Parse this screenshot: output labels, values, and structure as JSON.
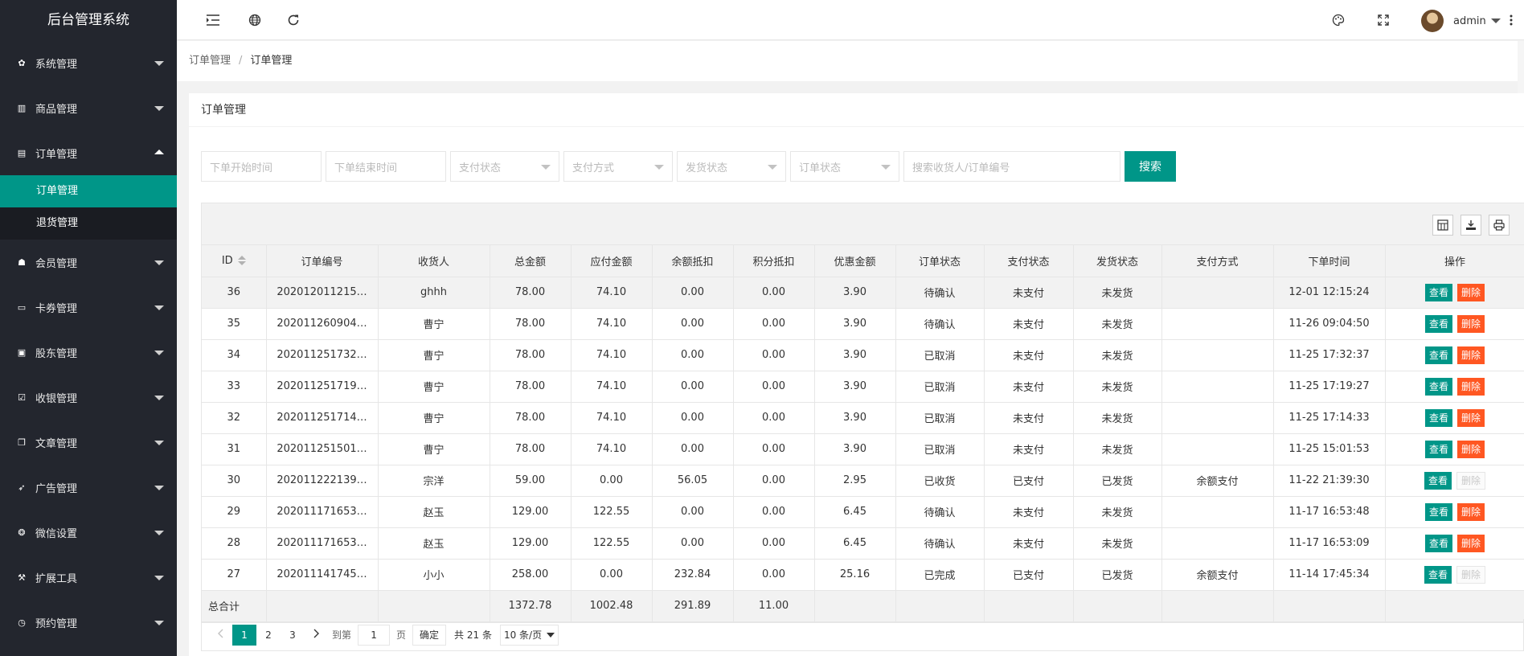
{
  "app": {
    "title": "后台管理系统",
    "username": "admin"
  },
  "sidebar": {
    "items": [
      {
        "label": "系统管理",
        "icon": "gear-icon"
      },
      {
        "label": "商品管理",
        "icon": "chart-icon"
      },
      {
        "label": "订单管理",
        "icon": "calendar-icon",
        "open": true
      },
      {
        "label": "会员管理",
        "icon": "users-icon"
      },
      {
        "label": "卡券管理",
        "icon": "card-icon"
      },
      {
        "label": "股东管理",
        "icon": "contact-icon"
      },
      {
        "label": "收银管理",
        "icon": "check-square-icon"
      },
      {
        "label": "文章管理",
        "icon": "file-icon"
      },
      {
        "label": "广告管理",
        "icon": "rocket-icon"
      },
      {
        "label": "微信设置",
        "icon": "wechat-icon"
      },
      {
        "label": "扩展工具",
        "icon": "wrench-icon"
      },
      {
        "label": "预约管理",
        "icon": "clock-icon"
      }
    ],
    "submenu": [
      {
        "label": "订单管理",
        "active": true
      },
      {
        "label": "退货管理",
        "active": false
      }
    ]
  },
  "breadcrumb": {
    "parent": "订单管理",
    "sep": "/",
    "current": "订单管理"
  },
  "card": {
    "title": "订单管理"
  },
  "filters": {
    "start_time": "下单开始时间",
    "end_time": "下单结束时间",
    "pay_status": "支付状态",
    "pay_method": "支付方式",
    "ship_status": "发货状态",
    "order_status": "订单状态",
    "keyword": "搜索收货人/订单编号",
    "search": "搜索"
  },
  "table": {
    "columns": [
      "ID",
      "订单编号",
      "收货人",
      "总金额",
      "应付金额",
      "余额抵扣",
      "积分抵扣",
      "优惠金额",
      "订单状态",
      "支付状态",
      "发货状态",
      "支付方式",
      "下单时间",
      "操作"
    ],
    "rows": [
      [
        "36",
        "202012011215…",
        "ghhh",
        "78.00",
        "74.10",
        "0.00",
        "0.00",
        "3.90",
        "待确认",
        "未支付",
        "未发货",
        "",
        "12-01 12:15:24"
      ],
      [
        "35",
        "202011260904…",
        "曹宁",
        "78.00",
        "74.10",
        "0.00",
        "0.00",
        "3.90",
        "待确认",
        "未支付",
        "未发货",
        "",
        "11-26 09:04:50"
      ],
      [
        "34",
        "202011251732…",
        "曹宁",
        "78.00",
        "74.10",
        "0.00",
        "0.00",
        "3.90",
        "已取消",
        "未支付",
        "未发货",
        "",
        "11-25 17:32:37"
      ],
      [
        "33",
        "202011251719…",
        "曹宁",
        "78.00",
        "74.10",
        "0.00",
        "0.00",
        "3.90",
        "已取消",
        "未支付",
        "未发货",
        "",
        "11-25 17:19:27"
      ],
      [
        "32",
        "202011251714…",
        "曹宁",
        "78.00",
        "74.10",
        "0.00",
        "0.00",
        "3.90",
        "已取消",
        "未支付",
        "未发货",
        "",
        "11-25 17:14:33"
      ],
      [
        "31",
        "202011251501…",
        "曹宁",
        "78.00",
        "74.10",
        "0.00",
        "0.00",
        "3.90",
        "已取消",
        "未支付",
        "未发货",
        "",
        "11-25 15:01:53"
      ],
      [
        "30",
        "202011222139…",
        "宗洋",
        "59.00",
        "0.00",
        "56.05",
        "0.00",
        "2.95",
        "已收货",
        "已支付",
        "已发货",
        "余额支付",
        "11-22 21:39:30"
      ],
      [
        "29",
        "202011171653…",
        "赵玉",
        "129.00",
        "122.55",
        "0.00",
        "0.00",
        "6.45",
        "待确认",
        "未支付",
        "未发货",
        "",
        "11-17 16:53:48"
      ],
      [
        "28",
        "202011171653…",
        "赵玉",
        "129.00",
        "122.55",
        "0.00",
        "0.00",
        "6.45",
        "待确认",
        "未支付",
        "未发货",
        "",
        "11-17 16:53:09"
      ],
      [
        "27",
        "202011141745…",
        "小小",
        "258.00",
        "0.00",
        "232.84",
        "0.00",
        "25.16",
        "已完成",
        "已支付",
        "已发货",
        "余额支付",
        "11-14 17:45:34"
      ]
    ],
    "delete_enabled": [
      true,
      true,
      true,
      true,
      true,
      true,
      false,
      true,
      true,
      false
    ],
    "total": {
      "label": "总合计",
      "total_amount": "1372.78",
      "payable": "1002.48",
      "balance": "291.89",
      "points": "11.00"
    },
    "actions": {
      "view": "查看",
      "delete": "删除"
    }
  },
  "pager": {
    "pages": [
      "1",
      "2",
      "3"
    ],
    "current": "1",
    "goto_label": "到第",
    "goto_value": "1",
    "page_unit": "页",
    "confirm": "确定",
    "total": "共 21 条",
    "page_size": "10 条/页"
  },
  "colors": {
    "accent": "#009688",
    "danger": "#ff5722",
    "sidebar": "#23262e"
  }
}
